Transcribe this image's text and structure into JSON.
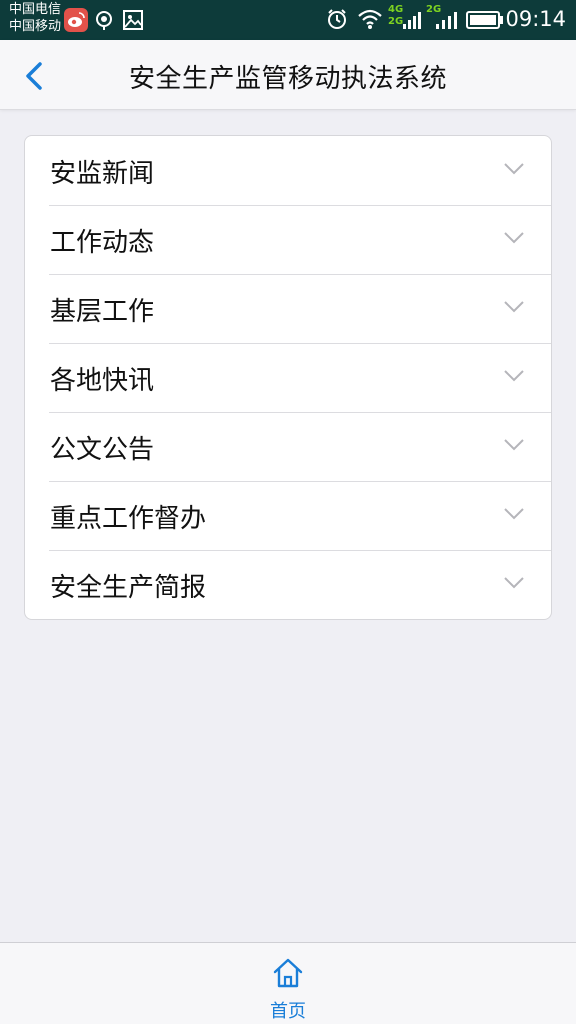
{
  "status_bar": {
    "carrier_1": "中国电信",
    "carrier_2": "中国移动",
    "network_1": "4G",
    "network_2": "2G",
    "network_3": "2G",
    "time": "09:14",
    "icons": [
      "weibo-icon",
      "eye-icon",
      "image-icon",
      "alarm-icon",
      "wifi-icon",
      "signal-icon",
      "signal-icon",
      "battery-icon"
    ]
  },
  "header": {
    "title": "安全生产监管移动执法系统",
    "back_icon": "chevron-left-icon"
  },
  "menu": {
    "items": [
      {
        "label": "安监新闻"
      },
      {
        "label": "工作动态"
      },
      {
        "label": "基层工作"
      },
      {
        "label": "各地快讯"
      },
      {
        "label": "公文公告"
      },
      {
        "label": "重点工作督办"
      },
      {
        "label": "安全生产简报"
      }
    ],
    "expand_icon": "chevron-down-icon"
  },
  "tab_bar": {
    "home_label": "首页",
    "home_icon": "home-icon"
  },
  "colors": {
    "status_bar_bg": "#0d3b3a",
    "accent": "#1a7ed8",
    "background": "#efeff4",
    "network_green": "#7ed321"
  }
}
